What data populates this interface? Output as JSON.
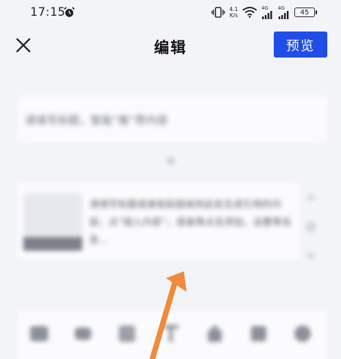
{
  "status_bar": {
    "time": "17:15",
    "speed_value": "4.1",
    "speed_unit": "K/s",
    "network_1": "4G",
    "network_2": "4G",
    "battery": "45"
  },
  "header": {
    "title": "编辑",
    "preview_label": "预览"
  },
  "content": {
    "title_placeholder": "请填写标题，智能“推”荐内容",
    "article_text": "请填写标题或者粘贴链接到此处生成引用的内容，点“插入内容”，或者再点击添加，设置等信息…"
  },
  "colors": {
    "accent": "#1f4de6",
    "arrow": "#f08a3c",
    "background": "#f3f4f8"
  }
}
